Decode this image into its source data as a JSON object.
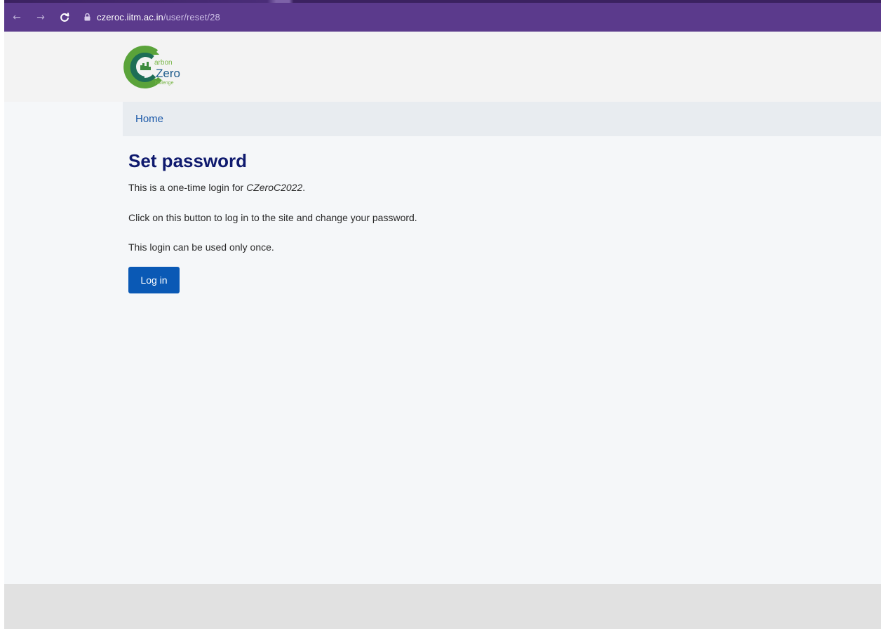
{
  "browser": {
    "url_host": "czeroc.iitm.ac.in",
    "url_path": "/user/reset/28",
    "toolbar_color": "#5b3a8c"
  },
  "header": {
    "logo": {
      "line1": "arbon",
      "line2": "Zero",
      "line3": "hallenge"
    }
  },
  "breadcrumb": {
    "home_label": "Home"
  },
  "main": {
    "title": "Set password",
    "intro_prefix": "This is a one-time login for ",
    "username": "CZeroC2022",
    "intro_suffix": ".",
    "instruction": "Click on this button to log in to the site and change your password.",
    "note": "This login can be used only once.",
    "login_button": "Log in",
    "accent_color": "#0a59b5",
    "title_color": "#0f1a6e"
  }
}
